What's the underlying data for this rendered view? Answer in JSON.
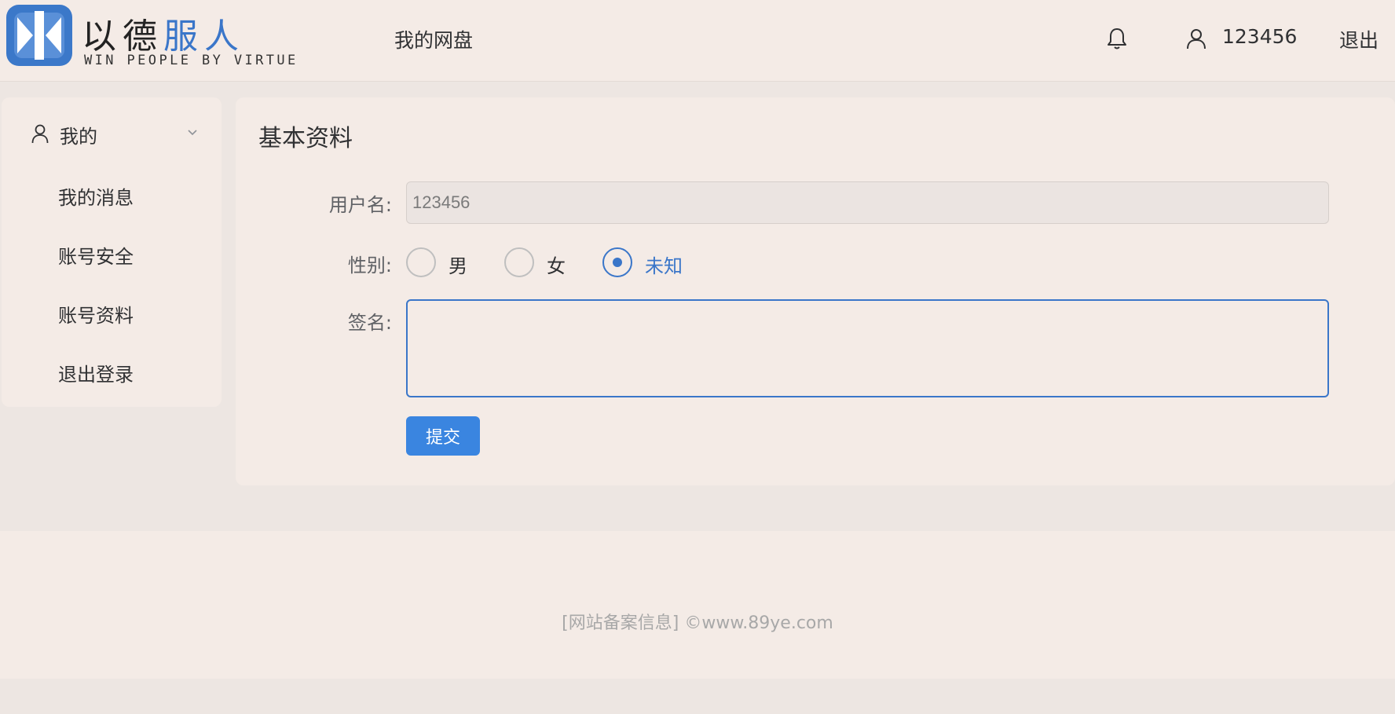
{
  "header": {
    "brand_cn_part1": "以德",
    "brand_cn_part2": "服人",
    "brand_en": "WIN PEOPLE BY VIRTUE",
    "nav_netdisk": "我的网盘",
    "username": "123456",
    "logout": "退出",
    "icons": [
      "bell-icon",
      "user-icon"
    ]
  },
  "sidebar": {
    "menu_title": "我的",
    "items": [
      {
        "label": "我的消息"
      },
      {
        "label": "账号安全"
      },
      {
        "label": "账号资料"
      },
      {
        "label": "退出登录"
      }
    ]
  },
  "main": {
    "title": "基本资料",
    "username_label": "用户名:",
    "username_value": "123456",
    "gender_label": "性别:",
    "gender_options": [
      {
        "label": "男",
        "checked": false
      },
      {
        "label": "女",
        "checked": false
      },
      {
        "label": "未知",
        "checked": true
      }
    ],
    "signature_label": "签名:",
    "signature_value": "",
    "submit_label": "提交"
  },
  "footer": {
    "text": "[网站备案信息] ©www.89ye.com"
  },
  "colors": {
    "accent": "#3a76c9",
    "button": "#3a85e0",
    "background": "#f4ebe6"
  }
}
